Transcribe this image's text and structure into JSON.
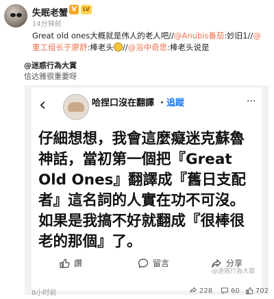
{
  "post": {
    "username": "失眠老蟹",
    "badge_v": "V",
    "badge_level": "LV",
    "timestamp": "14分钟前",
    "text_parts": {
      "p1": "Great old ones大概就是伟人的老人吧//",
      "m1": "@Anubis番茄",
      "p2": ":妙旧1//",
      "m2": "@重工组长于廖舒",
      "p3": ":棒老头",
      "p4": "//",
      "m3": "@浴中奇思",
      "p5": ":棒老头说是"
    }
  },
  "comment": {
    "user": "@迷惑行為大賞",
    "text": "信达雅很重要呀"
  },
  "fb": {
    "name": "哈捏口沒在翻譯",
    "separator": "・",
    "follow": "追蹤",
    "body": "仔細想想，我會這麼癡迷克蘇魯神話，當初第一個把『Great Old Ones』翻譯成『舊日支配者』這名詞的人實在功不可沒。如果是我搞不好就翻成『很棒很老的那個』了。",
    "actions": {
      "like": "讚",
      "comment": "留言",
      "share": "分享"
    },
    "watermark": "@迷惑行為大賞"
  },
  "footer": {
    "time": "8小时前",
    "reposts": "228",
    "comments": "60",
    "likes": "702"
  },
  "colors": {
    "mention": "#eb7350",
    "follow": "#1877f2"
  }
}
